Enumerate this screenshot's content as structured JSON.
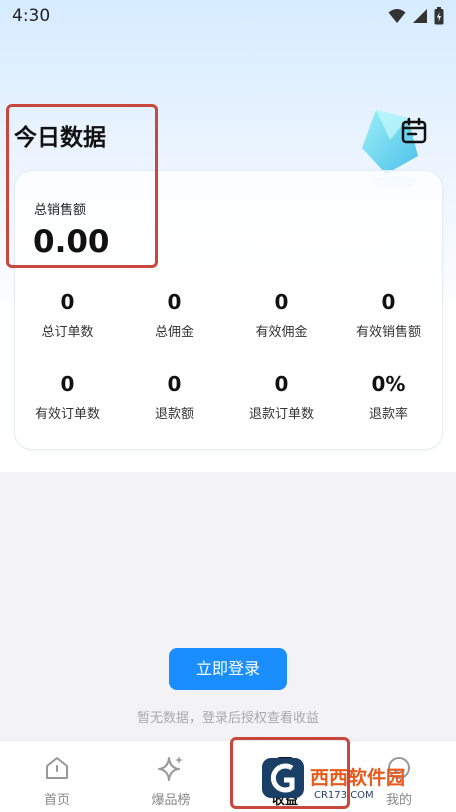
{
  "status": {
    "time": "4:30"
  },
  "header": {
    "title": "今日数据"
  },
  "summary": {
    "label": "总销售额",
    "value": "0.00"
  },
  "metrics": [
    {
      "value": "0",
      "label": "总订单数"
    },
    {
      "value": "0",
      "label": "总佣金"
    },
    {
      "value": "0",
      "label": "有效佣金"
    },
    {
      "value": "0",
      "label": "有效销售额"
    },
    {
      "value": "0",
      "label": "有效订单数"
    },
    {
      "value": "0",
      "label": "退款额"
    },
    {
      "value": "0",
      "label": "退款订单数"
    },
    {
      "value": "0%",
      "label": "退款率"
    }
  ],
  "empty": {
    "button": "立即登录",
    "hint": "暂无数据，登录后授权查看收益"
  },
  "tabs": [
    {
      "label": "首页",
      "icon": "home-icon"
    },
    {
      "label": "爆品榜",
      "icon": "sparkle-icon"
    },
    {
      "label": "收益",
      "icon": "earnings-icon"
    },
    {
      "label": "我的",
      "icon": "profile-icon"
    }
  ],
  "watermark": {
    "text": "西西软件园",
    "sub": "CR173.COM"
  },
  "colors": {
    "primary": "#1a8dff",
    "annotation": "#c9473c"
  }
}
